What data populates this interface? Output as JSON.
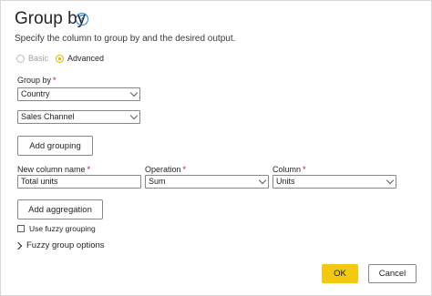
{
  "dialog": {
    "title": "Group by",
    "help_icon": "question-circle-icon",
    "subtitle": "Specify the column to group by and the desired output."
  },
  "mode": {
    "options": [
      {
        "label": "Basic",
        "selected": false,
        "disabled": true
      },
      {
        "label": "Advanced",
        "selected": true,
        "disabled": false
      }
    ]
  },
  "group_by": {
    "label": "Group by",
    "required_mark": "*",
    "fields": [
      "Country",
      "Sales Channel"
    ],
    "add_grouping_label": "Add grouping"
  },
  "aggregation": {
    "new_column_label": "New column name",
    "operation_label": "Operation",
    "column_label": "Column",
    "required_mark": "*",
    "new_column_value": "Total units",
    "operation_value": "Sum",
    "column_value": "Units",
    "add_aggregation_label": "Add aggregation"
  },
  "fuzzy": {
    "checkbox_label": "Use fuzzy grouping",
    "checked": false,
    "options_label": "Fuzzy group options"
  },
  "footer": {
    "ok_label": "OK",
    "cancel_label": "Cancel"
  },
  "colors": {
    "accent": "#f2c811",
    "help": "#2b7cd3",
    "required": "#c50f1f"
  }
}
